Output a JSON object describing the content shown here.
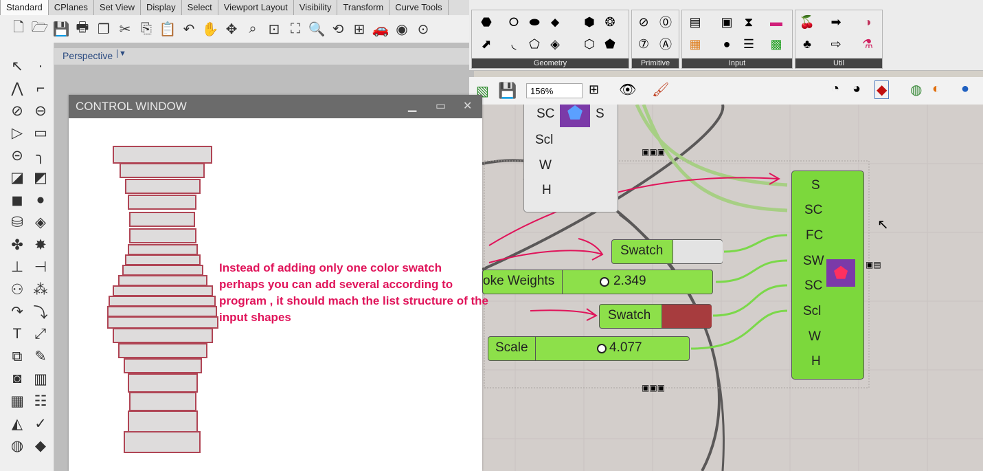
{
  "rhino": {
    "tabs": [
      "Standard",
      "CPlanes",
      "Set View",
      "Display",
      "Select",
      "Viewport Layout",
      "Visibility",
      "Transform",
      "Curve Tools"
    ],
    "viewport_label": "Perspective",
    "viewport_arrow": "▼"
  },
  "control_window": {
    "title": "CONTROL WINDOW",
    "minimize": "▁",
    "maximize": "▭",
    "close": "✕"
  },
  "annotation": {
    "lines": [
      "Instead of adding only one color swatch",
      "perhaps you can add several according to",
      "program , it should mach the list structure of the",
      "input  shapes"
    ]
  },
  "grasshopper": {
    "panels": [
      "Geometry",
      "Primitive",
      "Input",
      "Util"
    ],
    "zoom": "156%",
    "node_top": {
      "ports": [
        "SC",
        "Scl",
        "W",
        "H"
      ],
      "output": "S",
      "input_first": "SC"
    },
    "node_main": {
      "ports": [
        "S",
        "SC",
        "FC",
        "SW",
        "SC",
        "Scl",
        "W",
        "H"
      ]
    },
    "swatch1": {
      "label": "Swatch",
      "color": "#e3e3e3"
    },
    "swatch2": {
      "label": "Swatch",
      "color": "#a73c3e"
    },
    "slider_stroke": {
      "label": "oke Weights",
      "value": "2.349"
    },
    "slider_scale": {
      "label": "Scale",
      "value": "4.077"
    }
  }
}
